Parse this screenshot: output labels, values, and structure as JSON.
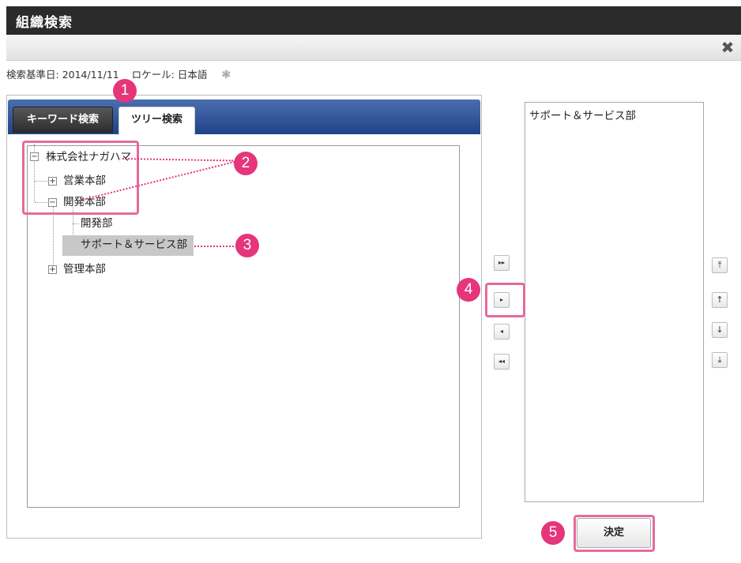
{
  "dialog": {
    "title": "組織検索",
    "close_icon": "✖"
  },
  "info": {
    "base_date_label": "検索基準日:",
    "base_date": "2014/11/11",
    "locale_label": "ロケール:",
    "locale": "日本語",
    "gear_icon": "❃"
  },
  "tabs": {
    "keyword": "キーワード検索",
    "tree": "ツリー検索"
  },
  "tree": {
    "root": "株式会社ナガハマ",
    "eigyo": "営業本部",
    "kaihatsu": "開発本部",
    "kaihatsubu": "開発部",
    "support": "サポート＆サービス部",
    "kanri": "管理本部",
    "toggle_plus": "+",
    "toggle_minus": "−"
  },
  "move_buttons": {
    "add_all": "▸▸",
    "add": "▸",
    "remove": "◂",
    "remove_all": "◂◂"
  },
  "order_buttons": {
    "top": "⤒",
    "up": "↑",
    "down": "↓",
    "bottom": "⤓"
  },
  "selected": {
    "items": [
      "サポート＆サービス部"
    ]
  },
  "confirm_label": "決定",
  "badges": [
    "1",
    "2",
    "3",
    "4",
    "5"
  ],
  "colors": {
    "accent": "#e5357b",
    "tab_blue": "#1f4386"
  }
}
